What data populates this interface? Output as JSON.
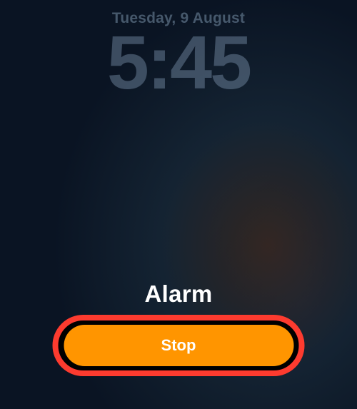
{
  "lockscreen": {
    "date": "Tuesday, 9 August",
    "time": "5:45"
  },
  "alarm": {
    "title": "Alarm",
    "stop_label": "Stop"
  },
  "colors": {
    "accent": "#ff9500",
    "highlight": "#fd3b2f"
  }
}
